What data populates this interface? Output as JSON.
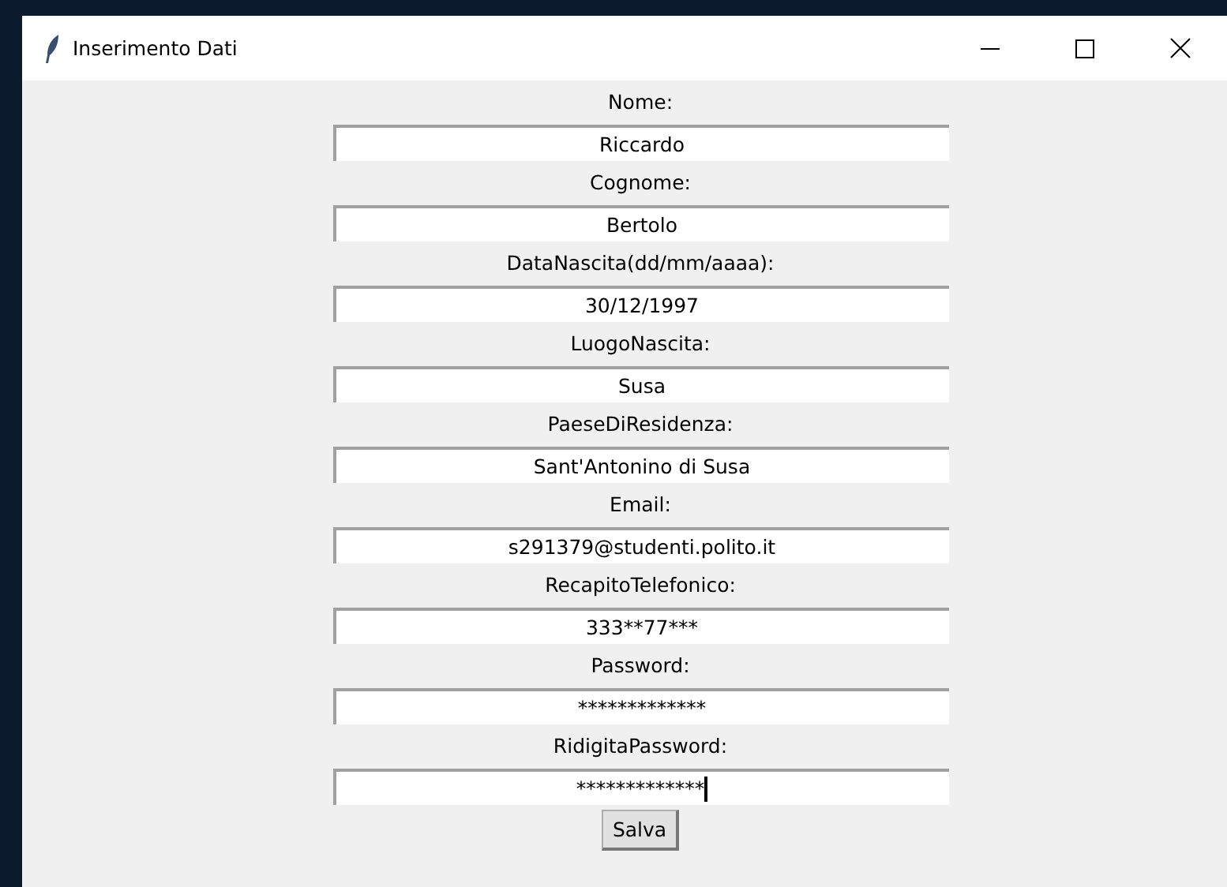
{
  "window": {
    "title": "Inserimento Dati"
  },
  "fields": [
    {
      "label": "Nome:",
      "value": "Riccardo",
      "focused": false
    },
    {
      "label": "Cognome:",
      "value": "Bertolo",
      "focused": false
    },
    {
      "label": "DataNascita(dd/mm/aaaa):",
      "value": "30/12/1997",
      "focused": false
    },
    {
      "label": "LuogoNascita:",
      "value": "Susa",
      "focused": false
    },
    {
      "label": "PaeseDiResidenza:",
      "value": "Sant'Antonino di Susa",
      "focused": false
    },
    {
      "label": "Email:",
      "value": "s291379@studenti.polito.it",
      "focused": false
    },
    {
      "label": "RecapitoTelefonico:",
      "value": "333**77***",
      "focused": false
    },
    {
      "label": "Password:",
      "value": "*************",
      "focused": false
    },
    {
      "label": "RidigitaPassword:",
      "value": "*************",
      "focused": true
    }
  ],
  "buttons": [
    "Salva"
  ]
}
